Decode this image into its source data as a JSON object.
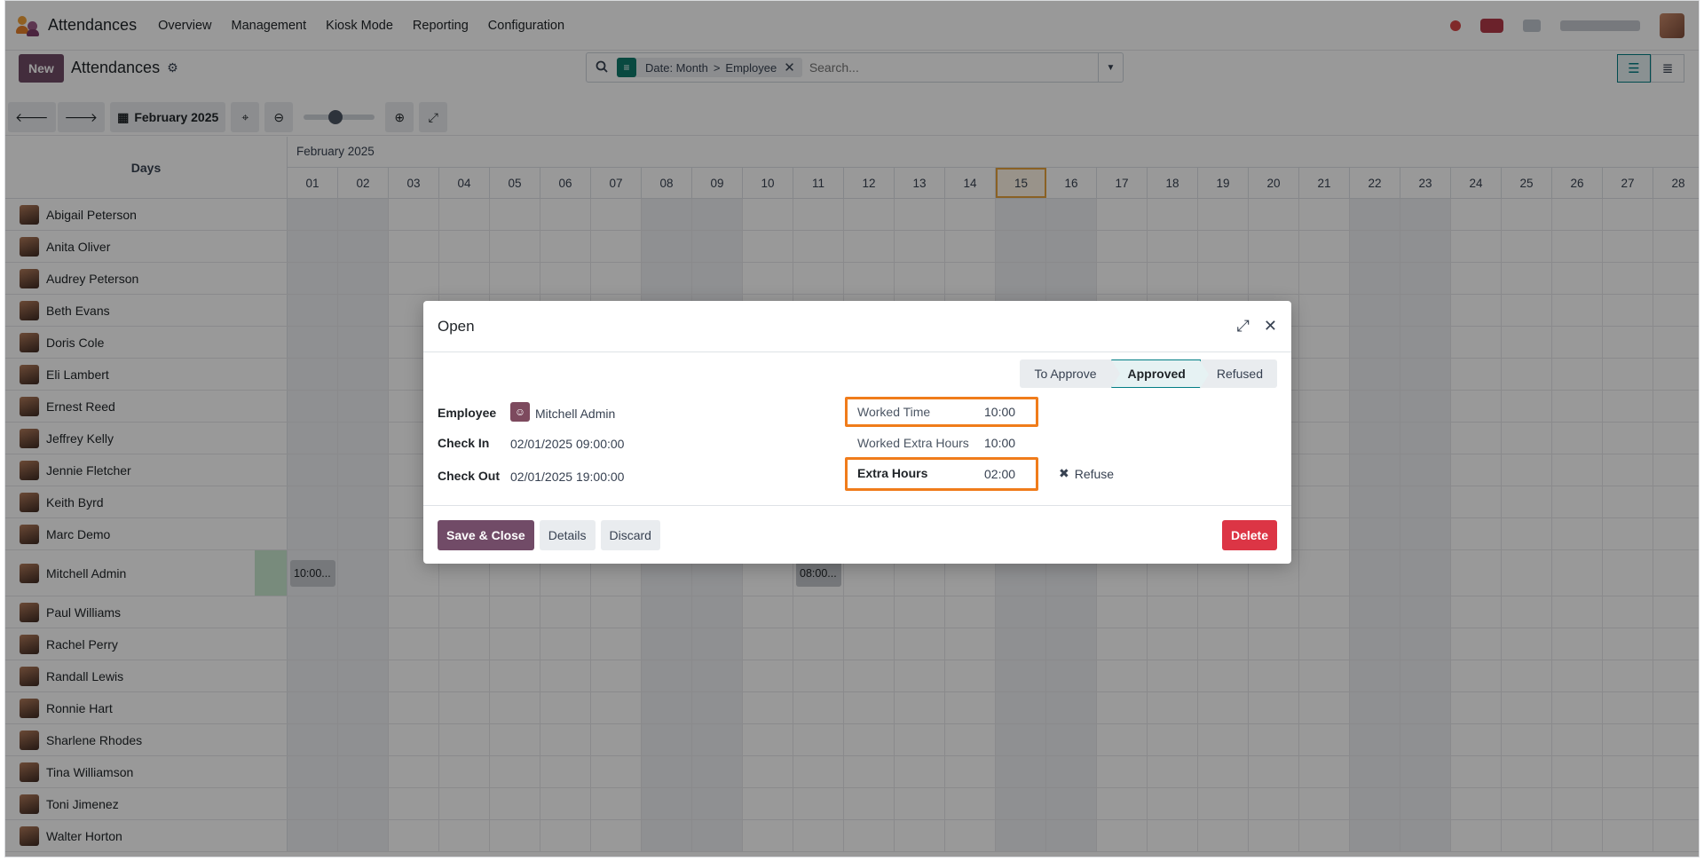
{
  "navbar": {
    "app_name": "Attendances",
    "menu": [
      "Overview",
      "Management",
      "Kiosk Mode",
      "Reporting",
      "Configuration"
    ]
  },
  "control": {
    "new_label": "New",
    "breadcrumb": "Attendances",
    "facet": {
      "part1": "Date: Month",
      "separator": ">",
      "part2": "Employee"
    },
    "search_placeholder": "Search...",
    "period_label": "February 2025"
  },
  "gantt": {
    "days_header": "Days",
    "month_label": "February 2025",
    "days": [
      "01",
      "02",
      "03",
      "04",
      "05",
      "06",
      "07",
      "08",
      "09",
      "10",
      "11",
      "12",
      "13",
      "14",
      "15",
      "16",
      "17",
      "18",
      "19",
      "20",
      "21",
      "22",
      "23",
      "24",
      "25",
      "26",
      "27",
      "28"
    ],
    "today": "15",
    "weekend_days": [
      "01",
      "02",
      "08",
      "09",
      "15",
      "16",
      "22",
      "23"
    ],
    "employees": [
      "Abigail Peterson",
      "Anita Oliver",
      "Audrey Peterson",
      "Beth Evans",
      "Doris Cole",
      "Eli Lambert",
      "Ernest Reed",
      "Jeffrey Kelly",
      "Jennie Fletcher",
      "Keith Byrd",
      "Marc Demo",
      "Mitchell Admin",
      "Paul Williams",
      "Rachel Perry",
      "Randall Lewis",
      "Ronnie Hart",
      "Sharlene Rhodes",
      "Tina Williamson",
      "Toni Jimenez",
      "Walter Horton"
    ],
    "pills": [
      {
        "employee": "Mitchell Admin",
        "day": "01",
        "label": "10:00..."
      },
      {
        "employee": "Mitchell Admin",
        "day": "11",
        "label": "08:00..."
      }
    ]
  },
  "modal": {
    "title": "Open",
    "stages": [
      "To Approve",
      "Approved",
      "Refused"
    ],
    "current_stage": "Approved",
    "employee_label": "Employee",
    "employee_value": "Mitchell Admin",
    "check_in_label": "Check In",
    "check_in_value": "02/01/2025 09:00:00",
    "check_out_label": "Check Out",
    "check_out_value": "02/01/2025 19:00:00",
    "worked_time_label": "Worked Time",
    "worked_time_value": "10:00",
    "worked_extra_label": "Worked Extra Hours",
    "worked_extra_value": "10:00",
    "extra_hours_label": "Extra Hours",
    "extra_hours_value": "02:00",
    "refuse_label": "Refuse",
    "save_label": "Save & Close",
    "details_label": "Details",
    "discard_label": "Discard",
    "delete_label": "Delete"
  },
  "colors": {
    "brand": "#714b67",
    "accent": "#017e84",
    "danger": "#dc3545",
    "highlight": "#f07c1b"
  }
}
